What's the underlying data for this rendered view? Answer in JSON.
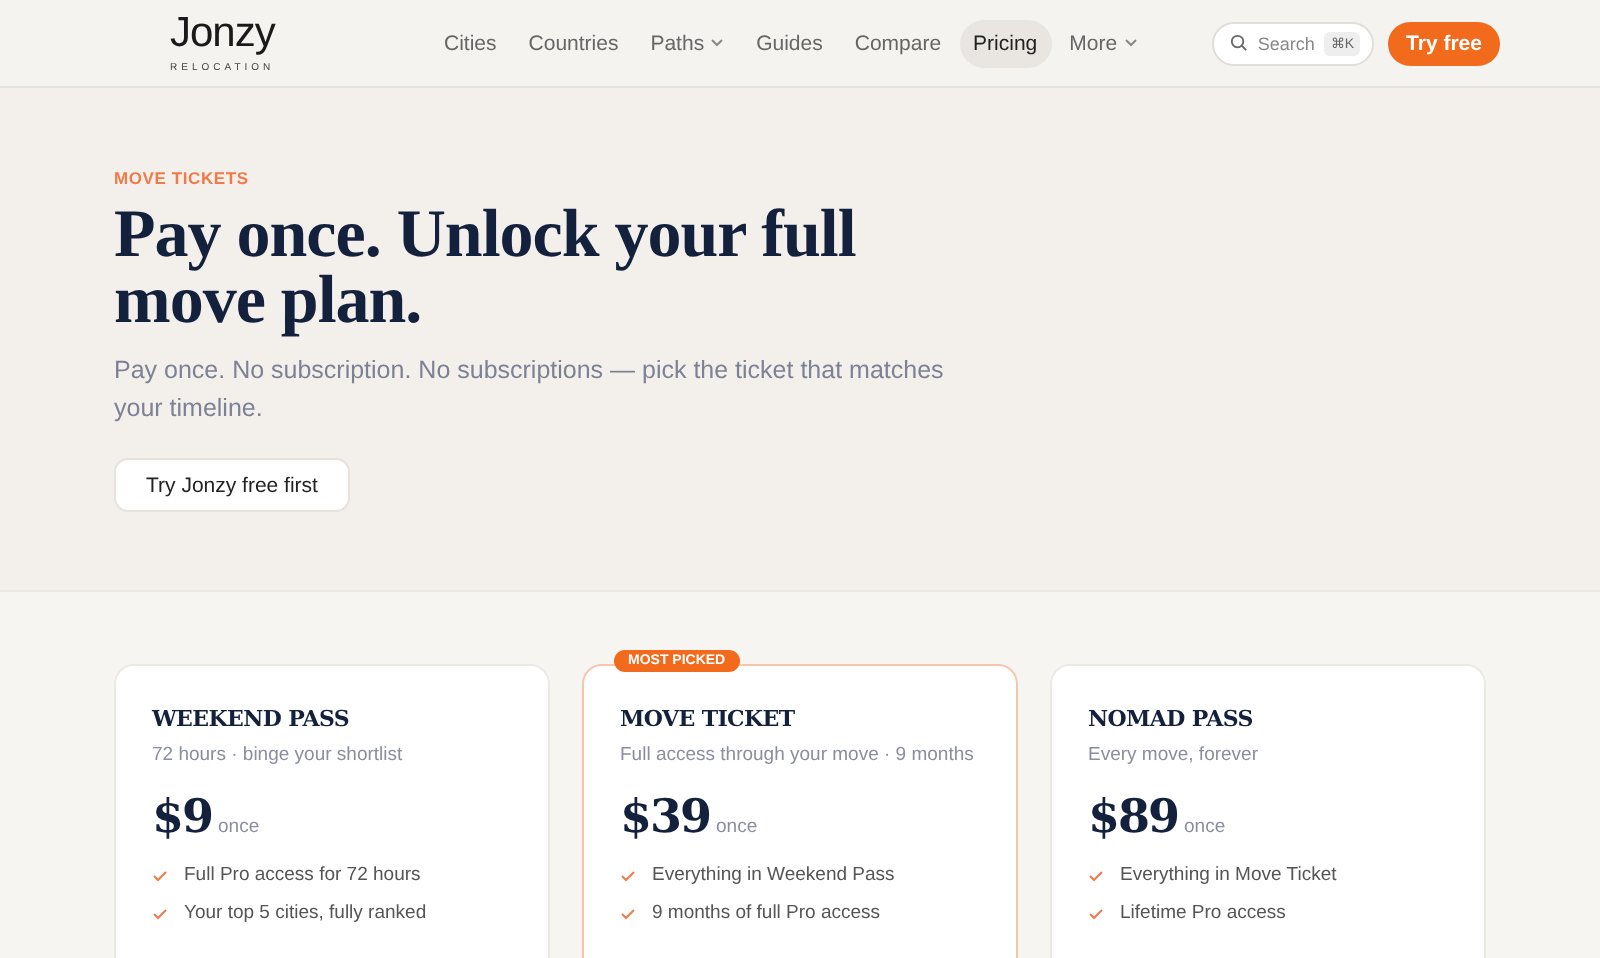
{
  "logo": {
    "name": "Jonzy",
    "tagline": "RELOCATION"
  },
  "nav": [
    {
      "label": "Cities",
      "selected": false,
      "dropdown": false
    },
    {
      "label": "Countries",
      "selected": false,
      "dropdown": false
    },
    {
      "label": "Paths",
      "selected": false,
      "dropdown": true
    },
    {
      "label": "Guides",
      "selected": false,
      "dropdown": false
    },
    {
      "label": "Compare",
      "selected": false,
      "dropdown": false
    },
    {
      "label": "Pricing",
      "selected": true,
      "dropdown": false
    },
    {
      "label": "More",
      "selected": false,
      "dropdown": true
    }
  ],
  "search": {
    "placeholder": "Search",
    "shortcut": "⌘K"
  },
  "cta": "Try free",
  "hero": {
    "eyebrow": "MOVE TICKETS",
    "title": "Pay once. Unlock your full move plan.",
    "subtitle": "Pay once. No subscription. No subscriptions — pick the ticket that matches your timeline.",
    "button": "Try Jonzy free first"
  },
  "plans": [
    {
      "name": "WEEKEND PASS",
      "desc": "72 hours · binge your shortlist",
      "price": "$9",
      "period": "once",
      "featured": false,
      "features": [
        "Full Pro access for 72 hours",
        "Your top 5 cities, fully ranked"
      ]
    },
    {
      "name": "MOVE TICKET",
      "desc": "Full access through your move · 9 months",
      "price": "$39",
      "period": "once",
      "featured": true,
      "badge": "MOST PICKED",
      "features": [
        "Everything in Weekend Pass",
        "9 months of full Pro access"
      ]
    },
    {
      "name": "NOMAD PASS",
      "desc": "Every move, forever",
      "price": "$89",
      "period": "once",
      "featured": false,
      "features": [
        "Everything in Move Ticket",
        "Lifetime Pro access"
      ]
    }
  ]
}
